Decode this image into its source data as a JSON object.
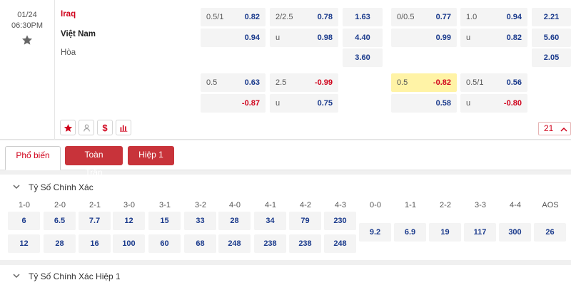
{
  "match": {
    "date": "01/24",
    "time": "06:30PM",
    "home": "Iraq",
    "away": "Việt Nam",
    "draw": "Hòa",
    "counter": "21"
  },
  "odds": {
    "ft_handicap": {
      "line": "0.5/1",
      "home": "0.82",
      "away": "0.94"
    },
    "ft_total": {
      "line": "2/2.5",
      "over": "0.78",
      "under_label": "u",
      "under": "0.98"
    },
    "ft_1x2": {
      "home": "1.63",
      "away": "4.40",
      "draw": "3.60"
    },
    "h1_handicap": {
      "line": "0/0.5",
      "home": "0.77",
      "away": "0.99"
    },
    "h1_total": {
      "line": "1.0",
      "over": "0.94",
      "under_label": "u",
      "under": "0.82"
    },
    "h1_1x2": {
      "home": "2.21",
      "away": "5.60",
      "draw": "2.05"
    },
    "ft_handicap2": {
      "line": "0.5",
      "home": "0.63",
      "away": "-0.87"
    },
    "ft_total2": {
      "line": "2.5",
      "over": "-0.99",
      "under_label": "u",
      "under": "0.75"
    },
    "h1_handicap2": {
      "line": "0.5",
      "home": "-0.82",
      "away": "0.58"
    },
    "h1_total2": {
      "line": "0.5/1",
      "over": "0.56",
      "under_label": "u",
      "under": "-0.80"
    }
  },
  "tabs": [
    "Phổ biến",
    "Toàn Trận",
    "Hiệp 1"
  ],
  "correct_score": {
    "title": "Tỷ Số Chính Xác",
    "headers": [
      "1-0",
      "2-0",
      "2-1",
      "3-0",
      "3-1",
      "3-2",
      "4-0",
      "4-1",
      "4-2",
      "4-3",
      "0-0",
      "1-1",
      "2-2",
      "3-3",
      "4-4",
      "AOS"
    ],
    "home_row": [
      "6",
      "6.5",
      "7.7",
      "12",
      "15",
      "33",
      "28",
      "34",
      "79",
      "230"
    ],
    "away_row": [
      "12",
      "28",
      "16",
      "100",
      "60",
      "68",
      "248",
      "238",
      "238",
      "248"
    ],
    "draw_row": [
      "9.2",
      "6.9",
      "19",
      "117",
      "300",
      "26"
    ]
  },
  "correct_score_h1": {
    "title": "Tỷ Số Chính Xác Hiệp 1"
  },
  "colors": {
    "accent": "#d0021b",
    "tab_button": "#c8333a",
    "odds_text": "#1a3a8c",
    "highlight": "#fff3a6"
  }
}
